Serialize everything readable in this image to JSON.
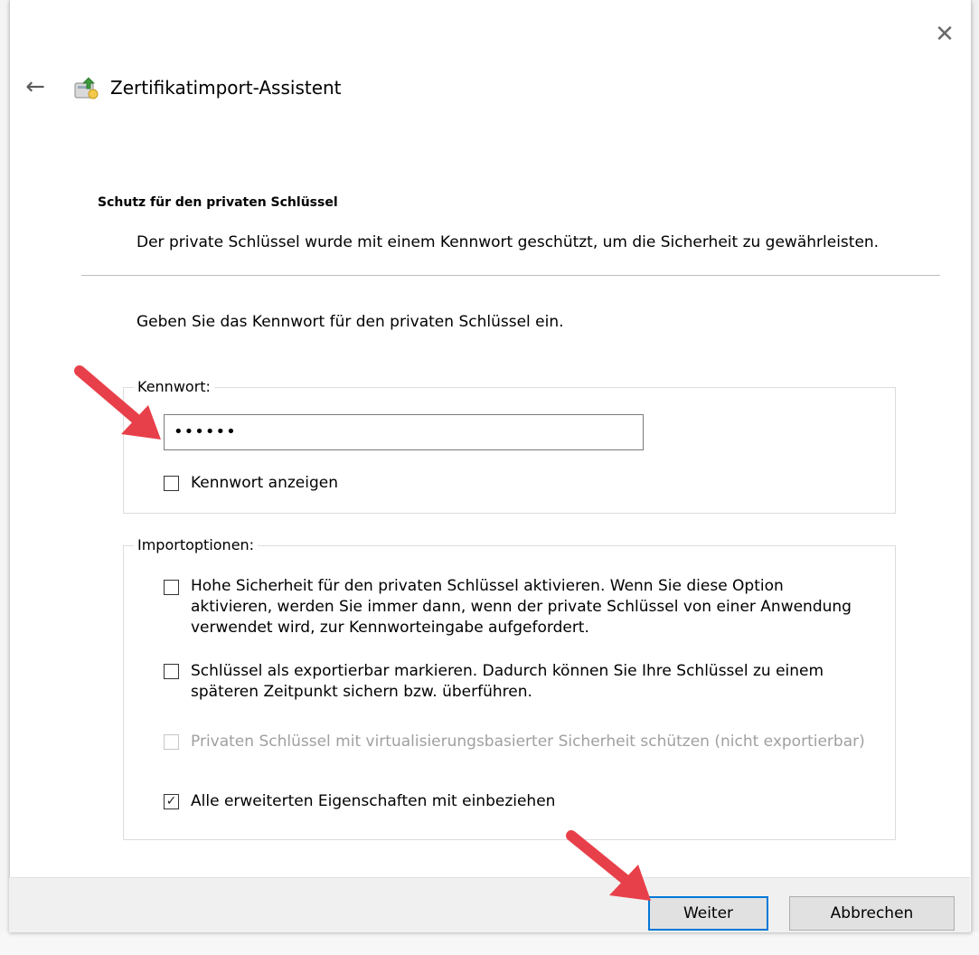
{
  "window": {
    "title": "Zertifikatimport-Assistent",
    "close_glyph": "✕",
    "back_glyph": "←"
  },
  "header": {
    "section_title": "Schutz für den privaten Schlüssel",
    "section_description": "Der private Schlüssel wurde mit einem Kennwort geschützt, um die Sicherheit zu gewährleisten."
  },
  "body": {
    "prompt": "Geben Sie das Kennwort für den privaten Schlüssel ein."
  },
  "password_group": {
    "legend": "Kennwort:",
    "value": "••••••",
    "show_password_label": "Kennwort anzeigen",
    "show_password_checked": false
  },
  "import_options": {
    "legend": "Importoptionen:",
    "options": [
      {
        "label": "Hohe Sicherheit für den privaten Schlüssel aktivieren. Wenn Sie diese Option aktivieren, werden Sie immer dann, wenn der private Schlüssel von einer Anwendung verwendet wird, zur Kennworteingabe aufgefordert.",
        "checked": false,
        "enabled": true
      },
      {
        "label": "Schlüssel als exportierbar markieren. Dadurch können Sie Ihre Schlüssel zu einem späteren Zeitpunkt sichern bzw. überführen.",
        "checked": false,
        "enabled": true
      },
      {
        "label": "Privaten Schlüssel mit virtualisierungsbasierter Sicherheit schützen (nicht exportierbar)",
        "checked": false,
        "enabled": false
      },
      {
        "label": "Alle erweiterten Eigenschaften mit einbeziehen",
        "checked": true,
        "enabled": true
      }
    ]
  },
  "footer": {
    "next_label": "Weiter",
    "cancel_label": "Abbrechen"
  },
  "colors": {
    "accent": "#0078d7",
    "annotation_arrow": "#e8404a",
    "footer_bg": "#f0f0f0"
  },
  "check_glyph": "✓"
}
